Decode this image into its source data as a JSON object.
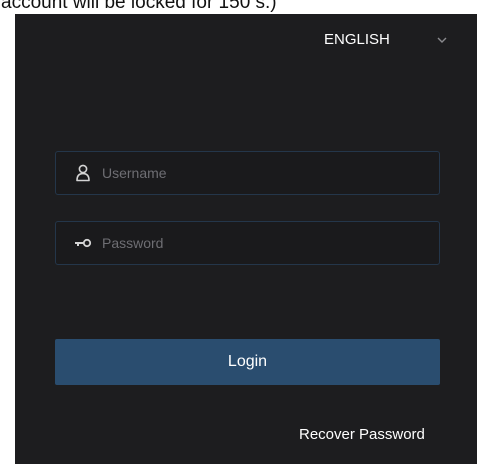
{
  "caption": "account will be locked for 150 s.)",
  "language": {
    "selected": "ENGLISH",
    "icon": "chevron-down-icon"
  },
  "form": {
    "username_placeholder": "Username",
    "username_icon": "user-icon",
    "password_placeholder": "Password",
    "password_icon": "key-icon",
    "login_label": "Login",
    "recover_label": "Recover Password"
  },
  "colors": {
    "background": "#1d1d1f",
    "button": "#2a4d6f",
    "field_border": "#24364a"
  }
}
